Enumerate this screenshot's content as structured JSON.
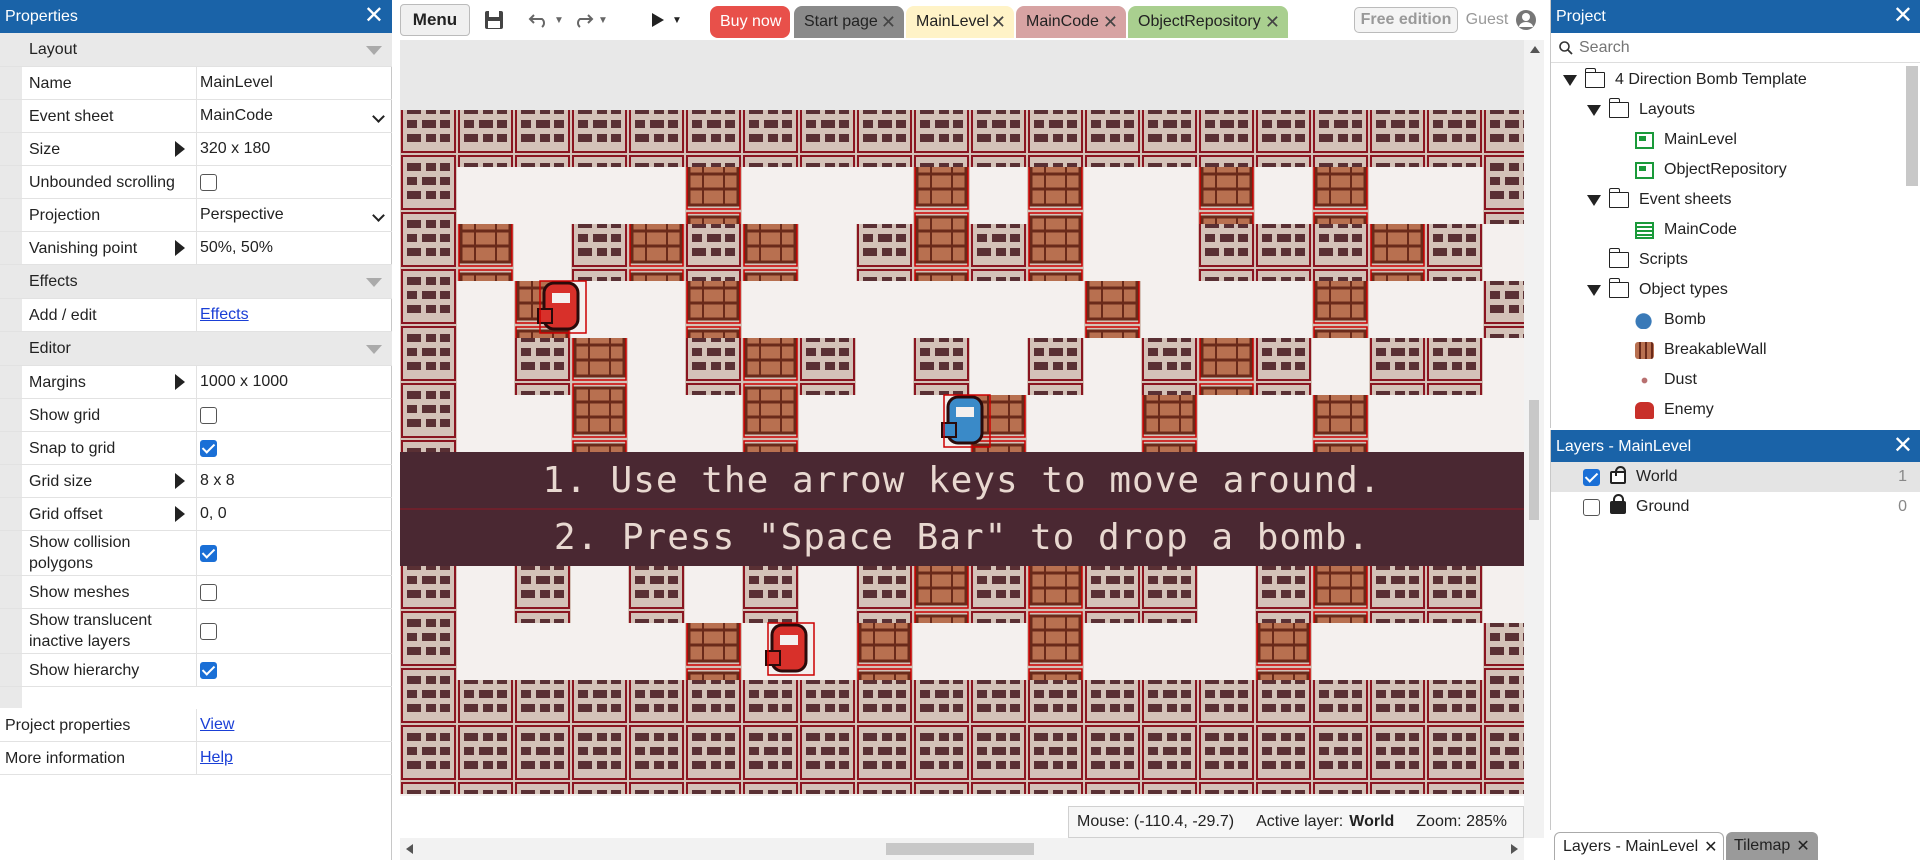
{
  "properties": {
    "title": "Properties",
    "close": "✕",
    "sections": {
      "layout": "Layout",
      "effects": "Effects",
      "editor": "Editor"
    },
    "rows": {
      "name": {
        "label": "Name",
        "value": "MainLevel"
      },
      "event_sheet": {
        "label": "Event sheet",
        "value": "MainCode"
      },
      "size": {
        "label": "Size",
        "value": "320 x 180"
      },
      "unbounded": {
        "label": "Unbounded scrolling",
        "checked": false
      },
      "projection": {
        "label": "Projection",
        "value": "Perspective"
      },
      "vanishing": {
        "label": "Vanishing point",
        "value": "50%, 50%"
      },
      "add_edit": {
        "label": "Add / edit",
        "value": "Effects"
      },
      "margins": {
        "label": "Margins",
        "value": "1000 x 1000"
      },
      "show_grid": {
        "label": "Show grid",
        "checked": false
      },
      "snap_grid": {
        "label": "Snap to grid",
        "checked": true
      },
      "grid_size": {
        "label": "Grid size",
        "value": "8 x 8"
      },
      "grid_offset": {
        "label": "Grid offset",
        "value": "0, 0"
      },
      "collision": {
        "label": "Show collision polygons",
        "checked": true
      },
      "meshes": {
        "label": "Show meshes",
        "checked": false
      },
      "translucent": {
        "label": "Show translucent inactive layers",
        "checked": false
      },
      "hierarchy": {
        "label": "Show hierarchy",
        "checked": true
      },
      "project_props": {
        "label": "Project properties",
        "value": "View"
      },
      "more_info": {
        "label": "More information",
        "value": "Help"
      }
    }
  },
  "toolbar": {
    "menu": "Menu",
    "buy": "Buy now",
    "free_edition": "Free edition",
    "guest": "Guest",
    "tabs": [
      {
        "label": "Start page",
        "color": "#8a8a8a"
      },
      {
        "label": "MainLevel",
        "color": "#fff3c7"
      },
      {
        "label": "MainCode",
        "color": "#d7a3a3"
      },
      {
        "label": "ObjectRepository",
        "color": "#a9cf8f"
      }
    ]
  },
  "canvas": {
    "instruction1": "1. Use the arrow keys to move around.",
    "instruction2": "2. Press \"Space Bar\" to drop a bomb."
  },
  "status": {
    "mouse": "Mouse: (-110.4, -29.7)",
    "active_layer_label": "Active layer:",
    "active_layer": "World",
    "zoom": "Zoom: 285%"
  },
  "project": {
    "title": "Project",
    "search_placeholder": "Search",
    "root": "4 Direction Bomb Template",
    "layouts": "Layouts",
    "layout_items": [
      "MainLevel",
      "ObjectRepository"
    ],
    "event_sheets": "Event sheets",
    "event_items": [
      "MainCode"
    ],
    "scripts": "Scripts",
    "object_types": "Object types",
    "objects": [
      "Bomb",
      "BreakableWall",
      "Dust",
      "Enemy"
    ]
  },
  "layers_panel": {
    "title": "Layers - MainLevel",
    "layers": [
      {
        "name": "World",
        "index": "1",
        "visible": true
      },
      {
        "name": "Ground",
        "index": "0",
        "visible": false
      }
    ]
  },
  "bottom_tabs": [
    "Layers - MainLevel",
    "Tilemap"
  ],
  "colors": {
    "accent": "#1a63a8",
    "buy": "#e8504a",
    "wall": "#d4c2b8",
    "crate": "#b87050",
    "banner": "#4a2832"
  }
}
